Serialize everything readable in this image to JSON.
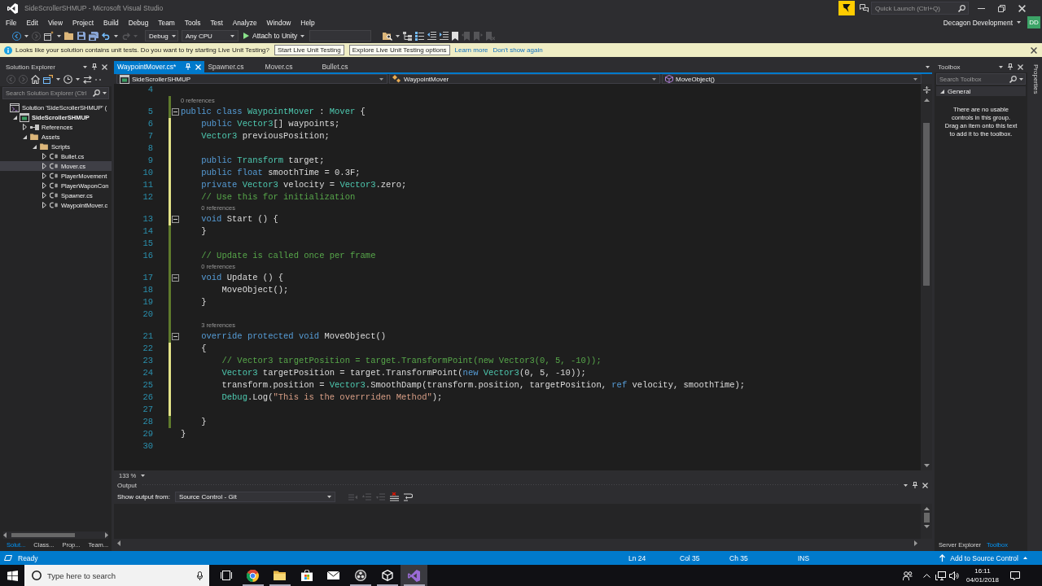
{
  "window": {
    "title": "SideScrollerSHMUP - Microsoft Visual Studio",
    "quick_launch": {
      "placeholder": "Quick Launch (Ctrl+Q)"
    }
  },
  "menu_bar": {
    "items": [
      "File",
      "Edit",
      "View",
      "Project",
      "Build",
      "Debug",
      "Team",
      "Tools",
      "Test",
      "Analyze",
      "Window",
      "Help"
    ],
    "account": {
      "name": "Decagon Development",
      "initials": "DD"
    }
  },
  "toolbar": {
    "tools_left": [
      {
        "kind": "back",
        "disabled": false
      },
      {
        "kind": "caret",
        "disabled": false
      },
      {
        "kind": "forward",
        "disabled": true
      },
      {
        "kind": "new-project",
        "disabled": false
      },
      {
        "kind": "caret",
        "disabled": false
      },
      {
        "kind": "open",
        "disabled": false
      },
      {
        "kind": "save",
        "disabled": false
      },
      {
        "kind": "save-all",
        "disabled": false
      },
      {
        "kind": "undo",
        "disabled": false
      },
      {
        "kind": "caret",
        "disabled": false
      },
      {
        "kind": "redo",
        "disabled": true
      },
      {
        "kind": "caret",
        "disabled": true
      }
    ],
    "configuration": "Debug",
    "platform": "Any CPU",
    "run": "Attach to Unity",
    "tools_right": [
      {
        "kind": "find-in-files",
        "disabled": false
      },
      {
        "kind": "caret",
        "disabled": false
      },
      {
        "kind": "hierarchy",
        "disabled": false
      },
      {
        "kind": "list",
        "disabled": false
      },
      {
        "kind": "outdent",
        "disabled": false
      },
      {
        "kind": "indent",
        "disabled": false
      },
      {
        "kind": "bookmark",
        "disabled": false
      },
      {
        "kind": "bookmark-prev",
        "disabled": true
      },
      {
        "kind": "bookmark-next",
        "disabled": true
      },
      {
        "kind": "bookmark-clear",
        "disabled": true
      }
    ]
  },
  "info_bar": {
    "message": "Looks like your solution contains unit tests. Do you want to try starting Live Unit Testing?",
    "buttons": [
      "Start Live Unit Testing",
      "Explore Live Unit Testing options"
    ],
    "links": [
      "Learn more",
      "Don't show again"
    ]
  },
  "solution_explorer": {
    "title": "Solution Explorer",
    "tools": [
      {
        "kind": "back",
        "disabled": true
      },
      {
        "kind": "forward",
        "disabled": true
      },
      {
        "kind": "home",
        "disabled": false
      },
      {
        "kind": "switch-views",
        "disabled": false
      },
      {
        "kind": "caret",
        "disabled": false
      },
      {
        "kind": "history",
        "disabled": false
      },
      {
        "kind": "caret",
        "disabled": false
      },
      {
        "kind": "sync",
        "disabled": false
      },
      {
        "kind": "more",
        "disabled": false
      }
    ],
    "search": {
      "placeholder": "Search Solution Explorer (Ctrl"
    },
    "tree": [
      {
        "label": "Solution 'SideScrollerSHMUP' (",
        "kind": "solution",
        "selected": false,
        "children": [
          {
            "label": "SideScrollerSHMUP",
            "kind": "project",
            "expanded": true,
            "selected": false,
            "children": [
              {
                "label": "References",
                "kind": "references",
                "expanded": false,
                "selected": false
              },
              {
                "label": "Assets",
                "kind": "folder",
                "expanded": true,
                "selected": false,
                "children": [
                  {
                    "label": "Scripts",
                    "kind": "folder",
                    "expanded": true,
                    "selected": false,
                    "children": [
                      {
                        "label": "Bullet.cs",
                        "kind": "file",
                        "expanded": false,
                        "selected": false
                      },
                      {
                        "label": "Mover.cs",
                        "kind": "file",
                        "expanded": false,
                        "selected": true
                      },
                      {
                        "label": "PlayerMovement",
                        "kind": "file",
                        "expanded": false,
                        "selected": false
                      },
                      {
                        "label": "PlayerWaponCon",
                        "kind": "file",
                        "expanded": false,
                        "selected": false
                      },
                      {
                        "label": "Spawner.cs",
                        "kind": "file",
                        "expanded": false,
                        "selected": false
                      },
                      {
                        "label": "WaypointMover.c",
                        "kind": "file",
                        "expanded": false,
                        "selected": false
                      }
                    ]
                  }
                ]
              }
            ]
          }
        ]
      }
    ],
    "tabs": [
      {
        "label": "Solut...",
        "selected": true
      },
      {
        "label": "Class...",
        "selected": false
      },
      {
        "label": "Prop...",
        "selected": false
      },
      {
        "label": "Team...",
        "selected": false
      }
    ]
  },
  "editor": {
    "tabs": [
      {
        "label": "WaypointMover.cs*",
        "selected": true
      },
      {
        "label": "Spawner.cs",
        "selected": false
      },
      {
        "label": "Mover.cs",
        "selected": false
      },
      {
        "label": "Bullet.cs",
        "selected": false
      }
    ],
    "navigation": [
      "SideScrollerSHMUP",
      "WaypointMover",
      "MoveObject()"
    ],
    "lines": [
      {
        "kind": "code",
        "number": "4",
        "modified": false,
        "fold": false
      },
      {
        "kind": "codelens",
        "text": "0 references",
        "modified": true,
        "saved": true
      },
      {
        "kind": "code",
        "number": "5",
        "modified": true,
        "saved": true,
        "fold": true,
        "tokens": [
          {
            "kind": "keyword",
            "text": "public class "
          },
          {
            "kind": "type",
            "text": "WaypointMover"
          },
          {
            "kind": "plain",
            "text": " : "
          },
          {
            "kind": "type",
            "text": "Mover"
          },
          {
            "kind": "plain",
            "text": " {"
          }
        ]
      },
      {
        "kind": "code",
        "number": "6",
        "modified": true,
        "saved": false,
        "fold": false,
        "tokens": [
          {
            "kind": "keyword",
            "text": "    public "
          },
          {
            "kind": "type",
            "text": "Vector3"
          },
          {
            "kind": "plain",
            "text": "[] waypoints;"
          }
        ]
      },
      {
        "kind": "code",
        "number": "7",
        "modified": true,
        "saved": false,
        "fold": false,
        "tokens": [
          {
            "kind": "type",
            "text": "    Vector3"
          },
          {
            "kind": "plain",
            "text": " previousPosition;"
          }
        ]
      },
      {
        "kind": "code",
        "number": "8",
        "modified": true,
        "saved": false,
        "fold": false
      },
      {
        "kind": "code",
        "number": "9",
        "modified": true,
        "saved": false,
        "fold": false,
        "tokens": [
          {
            "kind": "keyword",
            "text": "    public "
          },
          {
            "kind": "type",
            "text": "Transform"
          },
          {
            "kind": "plain",
            "text": " target;"
          }
        ]
      },
      {
        "kind": "code",
        "number": "10",
        "modified": true,
        "saved": false,
        "fold": false,
        "tokens": [
          {
            "kind": "keyword",
            "text": "    public float "
          },
          {
            "kind": "plain",
            "text": "smoothTime = 0.3F;"
          }
        ]
      },
      {
        "kind": "code",
        "number": "11",
        "modified": true,
        "saved": false,
        "fold": false,
        "tokens": [
          {
            "kind": "keyword",
            "text": "    private "
          },
          {
            "kind": "type",
            "text": "Vector3"
          },
          {
            "kind": "plain",
            "text": " velocity = "
          },
          {
            "kind": "type",
            "text": "Vector3"
          },
          {
            "kind": "plain",
            "text": ".zero;"
          }
        ]
      },
      {
        "kind": "code",
        "number": "12",
        "modified": true,
        "saved": false,
        "fold": false,
        "tokens": [
          {
            "kind": "comment",
            "text": "    // Use this for initialization"
          }
        ]
      },
      {
        "kind": "codelens",
        "text": "    0 references",
        "modified": true,
        "saved": false
      },
      {
        "kind": "code",
        "number": "13",
        "modified": true,
        "saved": false,
        "fold": true,
        "tokens": [
          {
            "kind": "keyword",
            "text": "    void "
          },
          {
            "kind": "plain",
            "text": "Start () {"
          }
        ]
      },
      {
        "kind": "code",
        "number": "14",
        "modified": true,
        "saved": true,
        "fold": false,
        "tokens": [
          {
            "kind": "plain",
            "text": "    }"
          }
        ]
      },
      {
        "kind": "code",
        "number": "15",
        "modified": true,
        "saved": true,
        "fold": false
      },
      {
        "kind": "code",
        "number": "16",
        "modified": true,
        "saved": true,
        "fold": false,
        "tokens": [
          {
            "kind": "comment",
            "text": "    // Update is called once per frame"
          }
        ]
      },
      {
        "kind": "codelens",
        "text": "    0 references",
        "modified": true,
        "saved": true
      },
      {
        "kind": "code",
        "number": "17",
        "modified": true,
        "saved": true,
        "fold": true,
        "tokens": [
          {
            "kind": "keyword",
            "text": "    void "
          },
          {
            "kind": "plain",
            "text": "Update () {"
          }
        ]
      },
      {
        "kind": "code",
        "number": "18",
        "modified": true,
        "saved": true,
        "fold": false,
        "tokens": [
          {
            "kind": "plain",
            "text": "        MoveObject();"
          }
        ]
      },
      {
        "kind": "code",
        "number": "19",
        "modified": true,
        "saved": true,
        "fold": false,
        "tokens": [
          {
            "kind": "plain",
            "text": "    }"
          }
        ]
      },
      {
        "kind": "code",
        "number": "20",
        "modified": true,
        "saved": true,
        "fold": false
      },
      {
        "kind": "codelens",
        "text": "    3 references",
        "modified": true,
        "saved": true
      },
      {
        "kind": "code",
        "number": "21",
        "modified": true,
        "saved": true,
        "fold": true,
        "tokens": [
          {
            "kind": "keyword",
            "text": "    override protected void "
          },
          {
            "kind": "plain",
            "text": "MoveObject()"
          }
        ]
      },
      {
        "kind": "code",
        "number": "22",
        "modified": true,
        "saved": false,
        "fold": false,
        "tokens": [
          {
            "kind": "plain",
            "text": "    {"
          }
        ]
      },
      {
        "kind": "code",
        "number": "23",
        "modified": true,
        "saved": false,
        "fold": false,
        "tokens": [
          {
            "kind": "comment",
            "text": "        // Vector3 targetPosition = target.TransformPoint(new Vector3(0, 5, -10));"
          }
        ]
      },
      {
        "kind": "code",
        "number": "24",
        "modified": true,
        "saved": false,
        "fold": false,
        "tokens": [
          {
            "kind": "type",
            "text": "        Vector3"
          },
          {
            "kind": "plain",
            "text": " targetPosition = target.TransformPoint("
          },
          {
            "kind": "keyword",
            "text": "new "
          },
          {
            "kind": "type",
            "text": "Vector3"
          },
          {
            "kind": "plain",
            "text": "(0, 5, -10));"
          }
        ]
      },
      {
        "kind": "code",
        "number": "25",
        "modified": true,
        "saved": false,
        "fold": false,
        "tokens": [
          {
            "kind": "plain",
            "text": "        transform.position = "
          },
          {
            "kind": "type",
            "text": "Vector3"
          },
          {
            "kind": "plain",
            "text": ".SmoothDamp(transform.position, targetPosition, "
          },
          {
            "kind": "keyword",
            "text": "ref "
          },
          {
            "kind": "plain",
            "text": "velocity, smoothTime);"
          }
        ]
      },
      {
        "kind": "code",
        "number": "26",
        "modified": true,
        "saved": false,
        "fold": false,
        "tokens": [
          {
            "kind": "type",
            "text": "        Debug"
          },
          {
            "kind": "plain",
            "text": ".Log("
          },
          {
            "kind": "string",
            "text": "\"This is the overrriden Method\""
          },
          {
            "kind": "plain",
            "text": ");"
          }
        ]
      },
      {
        "kind": "code",
        "number": "27",
        "modified": true,
        "saved": false,
        "fold": false
      },
      {
        "kind": "code",
        "number": "28",
        "modified": true,
        "saved": true,
        "fold": false,
        "tokens": [
          {
            "kind": "plain",
            "text": "    }"
          }
        ]
      },
      {
        "kind": "code",
        "number": "29",
        "modified": false,
        "fold": false,
        "tokens": [
          {
            "kind": "plain",
            "text": "}"
          }
        ]
      },
      {
        "kind": "code",
        "number": "30",
        "modified": false,
        "fold": false
      }
    ],
    "zoom": "133 %"
  },
  "output": {
    "title": "Output",
    "source_label": "Show output from:",
    "source": "Source Control - Git",
    "tools": [
      {
        "kind": "find",
        "disabled": true
      },
      {
        "kind": "previous",
        "disabled": true
      },
      {
        "kind": "next",
        "disabled": true
      },
      {
        "kind": "clear",
        "disabled": false
      },
      {
        "kind": "wrap",
        "disabled": false
      }
    ]
  },
  "toolbox": {
    "title": "Toolbox",
    "search": {
      "placeholder": "Search Toolbox"
    },
    "group": {
      "label": "General",
      "expanded": true
    },
    "message": "There are no usable controls in this group. Drag an item onto this text to add it to the toolbox.",
    "tabs": [
      {
        "label": "Server Explorer",
        "selected": false
      },
      {
        "label": "Toolbox",
        "selected": true
      }
    ]
  },
  "side_tab": {
    "label": "Properties"
  },
  "status_bar": {
    "status": "Ready",
    "fields": [
      "Ln 24",
      "Col 35",
      "Ch 35",
      "INS"
    ],
    "source_control": "Add to Source Control"
  },
  "taskbar": {
    "search": {
      "placeholder": "Type here to search"
    },
    "apps": [
      {
        "kind": "task-view",
        "running": false,
        "selected": false
      },
      {
        "kind": "browser",
        "running": true,
        "selected": false
      },
      {
        "kind": "files",
        "running": true,
        "selected": false
      },
      {
        "kind": "store",
        "running": false,
        "selected": false
      },
      {
        "kind": "mail",
        "running": false,
        "selected": false
      },
      {
        "kind": "recorder",
        "running": true,
        "selected": false
      },
      {
        "kind": "engine",
        "running": true,
        "selected": false
      },
      {
        "kind": "ide",
        "running": true,
        "selected": true
      }
    ],
    "time": "16:11",
    "date": "04/01/2018"
  }
}
